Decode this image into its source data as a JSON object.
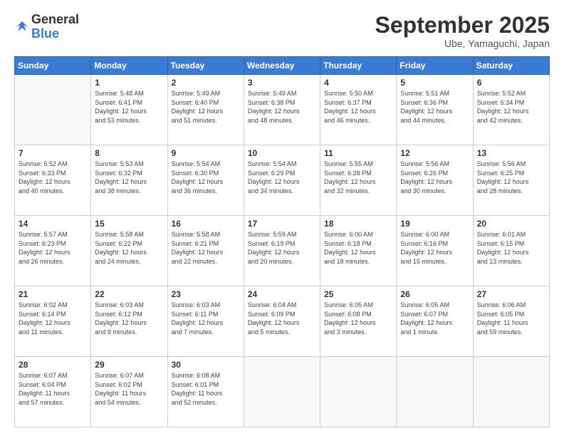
{
  "header": {
    "logo_general": "General",
    "logo_blue": "Blue",
    "month": "September 2025",
    "location": "Ube, Yamaguchi, Japan"
  },
  "weekdays": [
    "Sunday",
    "Monday",
    "Tuesday",
    "Wednesday",
    "Thursday",
    "Friday",
    "Saturday"
  ],
  "weeks": [
    [
      {
        "day": "",
        "info": ""
      },
      {
        "day": "1",
        "info": "Sunrise: 5:48 AM\nSunset: 6:41 PM\nDaylight: 12 hours\nand 53 minutes."
      },
      {
        "day": "2",
        "info": "Sunrise: 5:49 AM\nSunset: 6:40 PM\nDaylight: 12 hours\nand 51 minutes."
      },
      {
        "day": "3",
        "info": "Sunrise: 5:49 AM\nSunset: 6:38 PM\nDaylight: 12 hours\nand 48 minutes."
      },
      {
        "day": "4",
        "info": "Sunrise: 5:50 AM\nSunset: 6:37 PM\nDaylight: 12 hours\nand 46 minutes."
      },
      {
        "day": "5",
        "info": "Sunrise: 5:51 AM\nSunset: 6:36 PM\nDaylight: 12 hours\nand 44 minutes."
      },
      {
        "day": "6",
        "info": "Sunrise: 5:52 AM\nSunset: 6:34 PM\nDaylight: 12 hours\nand 42 minutes."
      }
    ],
    [
      {
        "day": "7",
        "info": "Sunrise: 5:52 AM\nSunset: 6:33 PM\nDaylight: 12 hours\nand 40 minutes."
      },
      {
        "day": "8",
        "info": "Sunrise: 5:53 AM\nSunset: 6:32 PM\nDaylight: 12 hours\nand 38 minutes."
      },
      {
        "day": "9",
        "info": "Sunrise: 5:54 AM\nSunset: 6:30 PM\nDaylight: 12 hours\nand 36 minutes."
      },
      {
        "day": "10",
        "info": "Sunrise: 5:54 AM\nSunset: 6:29 PM\nDaylight: 12 hours\nand 34 minutes."
      },
      {
        "day": "11",
        "info": "Sunrise: 5:55 AM\nSunset: 6:28 PM\nDaylight: 12 hours\nand 32 minutes."
      },
      {
        "day": "12",
        "info": "Sunrise: 5:56 AM\nSunset: 6:26 PM\nDaylight: 12 hours\nand 30 minutes."
      },
      {
        "day": "13",
        "info": "Sunrise: 5:56 AM\nSunset: 6:25 PM\nDaylight: 12 hours\nand 28 minutes."
      }
    ],
    [
      {
        "day": "14",
        "info": "Sunrise: 5:57 AM\nSunset: 6:23 PM\nDaylight: 12 hours\nand 26 minutes."
      },
      {
        "day": "15",
        "info": "Sunrise: 5:58 AM\nSunset: 6:22 PM\nDaylight: 12 hours\nand 24 minutes."
      },
      {
        "day": "16",
        "info": "Sunrise: 5:58 AM\nSunset: 6:21 PM\nDaylight: 12 hours\nand 22 minutes."
      },
      {
        "day": "17",
        "info": "Sunrise: 5:59 AM\nSunset: 6:19 PM\nDaylight: 12 hours\nand 20 minutes."
      },
      {
        "day": "18",
        "info": "Sunrise: 6:00 AM\nSunset: 6:18 PM\nDaylight: 12 hours\nand 18 minutes."
      },
      {
        "day": "19",
        "info": "Sunrise: 6:00 AM\nSunset: 6:16 PM\nDaylight: 12 hours\nand 15 minutes."
      },
      {
        "day": "20",
        "info": "Sunrise: 6:01 AM\nSunset: 6:15 PM\nDaylight: 12 hours\nand 13 minutes."
      }
    ],
    [
      {
        "day": "21",
        "info": "Sunrise: 6:02 AM\nSunset: 6:14 PM\nDaylight: 12 hours\nand 11 minutes."
      },
      {
        "day": "22",
        "info": "Sunrise: 6:03 AM\nSunset: 6:12 PM\nDaylight: 12 hours\nand 9 minutes."
      },
      {
        "day": "23",
        "info": "Sunrise: 6:03 AM\nSunset: 6:11 PM\nDaylight: 12 hours\nand 7 minutes."
      },
      {
        "day": "24",
        "info": "Sunrise: 6:04 AM\nSunset: 6:09 PM\nDaylight: 12 hours\nand 5 minutes."
      },
      {
        "day": "25",
        "info": "Sunrise: 6:05 AM\nSunset: 6:08 PM\nDaylight: 12 hours\nand 3 minutes."
      },
      {
        "day": "26",
        "info": "Sunrise: 6:05 AM\nSunset: 6:07 PM\nDaylight: 12 hours\nand 1 minute."
      },
      {
        "day": "27",
        "info": "Sunrise: 6:06 AM\nSunset: 6:05 PM\nDaylight: 11 hours\nand 59 minutes."
      }
    ],
    [
      {
        "day": "28",
        "info": "Sunrise: 6:07 AM\nSunset: 6:04 PM\nDaylight: 11 hours\nand 57 minutes."
      },
      {
        "day": "29",
        "info": "Sunrise: 6:07 AM\nSunset: 6:02 PM\nDaylight: 11 hours\nand 54 minutes."
      },
      {
        "day": "30",
        "info": "Sunrise: 6:08 AM\nSunset: 6:01 PM\nDaylight: 11 hours\nand 52 minutes."
      },
      {
        "day": "",
        "info": ""
      },
      {
        "day": "",
        "info": ""
      },
      {
        "day": "",
        "info": ""
      },
      {
        "day": "",
        "info": ""
      }
    ]
  ]
}
